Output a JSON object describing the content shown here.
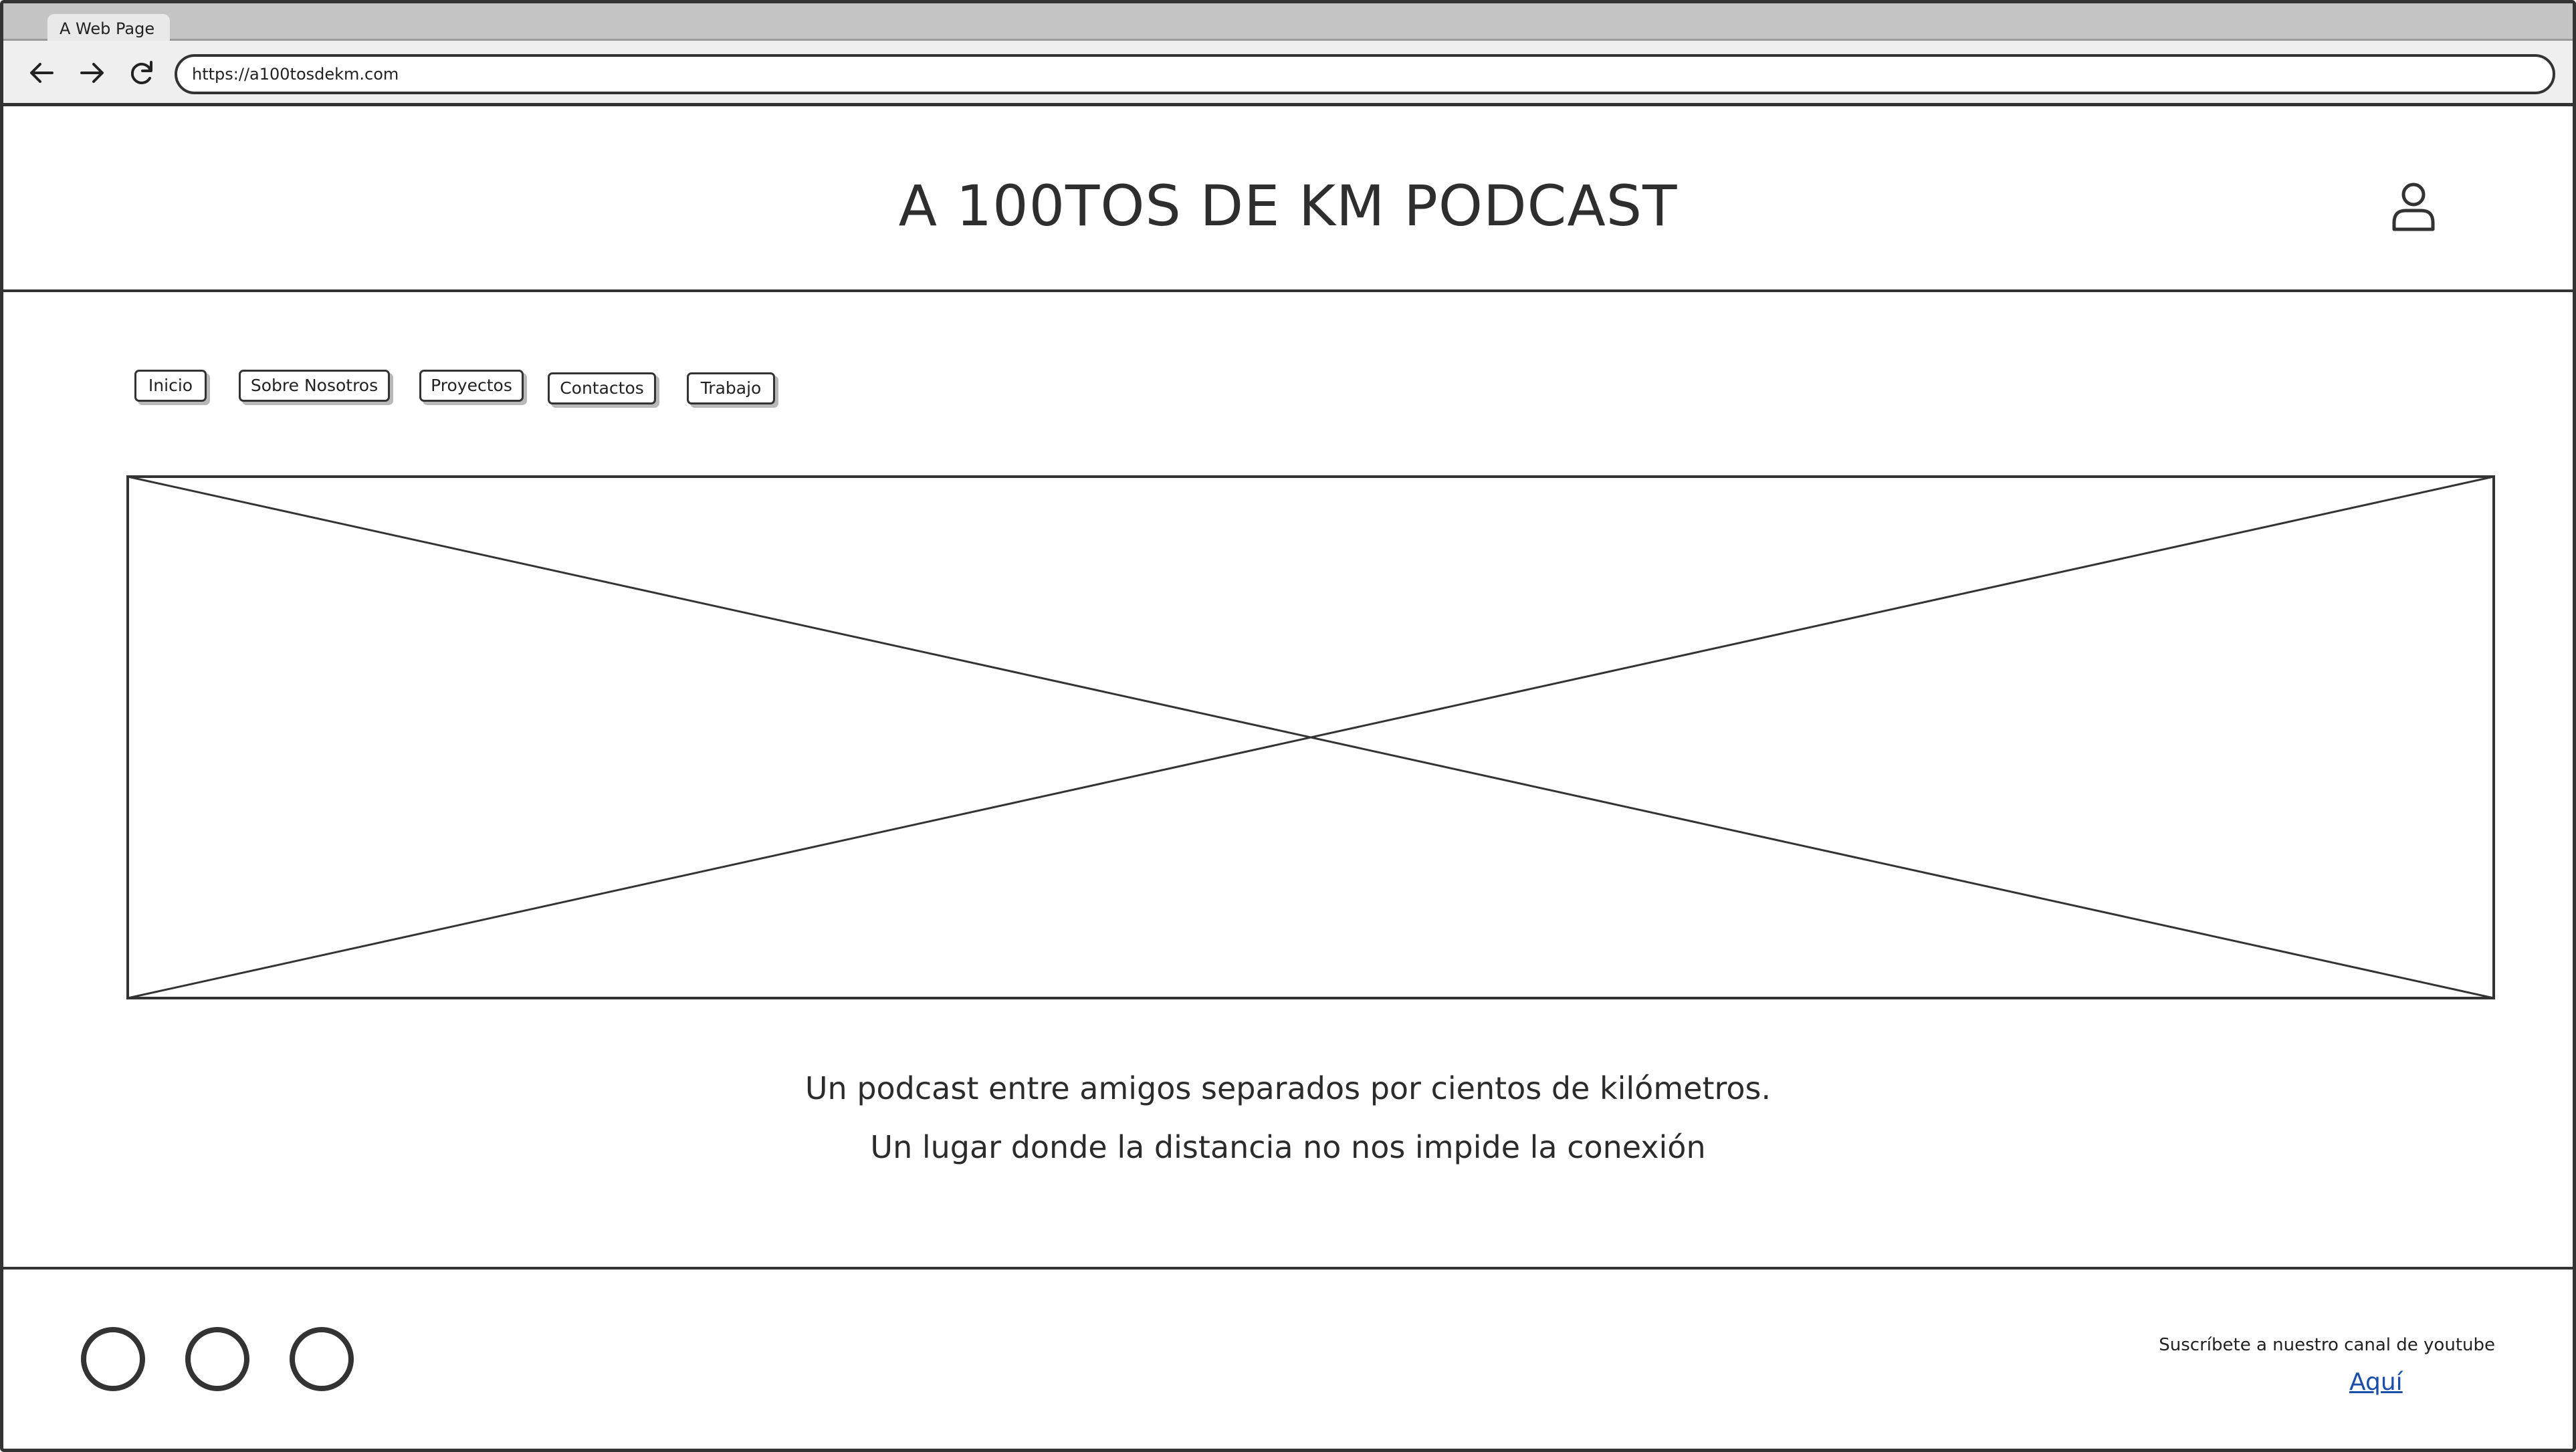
{
  "browser": {
    "tab_title": "A Web Page",
    "url": "https://a100tosdekm.com"
  },
  "header": {
    "title": "A 100TOS DE KM PODCAST",
    "user_icon": "user-icon"
  },
  "nav": {
    "items": [
      {
        "label": "Inicio"
      },
      {
        "label": "Sobre Nosotros"
      },
      {
        "label": "Proyectos"
      },
      {
        "label": "Contactos"
      },
      {
        "label": "Trabajo"
      }
    ]
  },
  "main": {
    "image_placeholder": "image-placeholder",
    "tagline_1": "Un podcast entre amigos separados por cientos de kilómetros.",
    "tagline_2": "Un lugar donde la distancia no nos impide la conexión"
  },
  "footer": {
    "social_icons": [
      "social-icon-1",
      "social-icon-2",
      "social-icon-3"
    ],
    "subscribe_text": "Suscríbete a nuestro canal de youtube",
    "link_text": "Aquí",
    "link_color": "#1a4ea8"
  }
}
